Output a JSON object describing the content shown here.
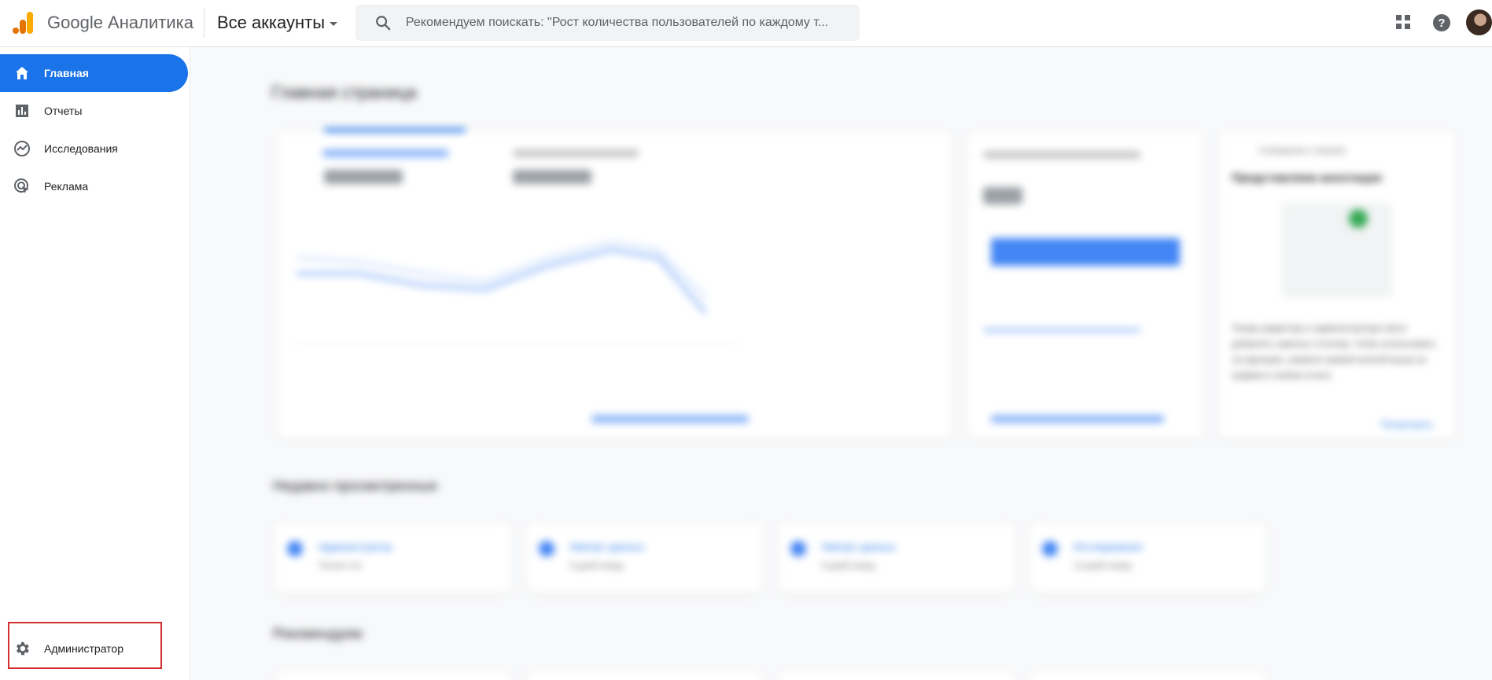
{
  "header": {
    "app_name": "Google Аналитика",
    "account_picker": "Все аккаунты",
    "search_placeholder": "Рекомендуем поискать: \"Рост количества пользователей по каждому т..."
  },
  "sidebar": {
    "items": [
      {
        "label": "Главная",
        "icon": "home-icon",
        "active": true
      },
      {
        "label": "Отчеты",
        "icon": "bar-chart-icon",
        "active": false
      },
      {
        "label": "Исследования",
        "icon": "explore-icon",
        "active": false
      },
      {
        "label": "Реклама",
        "icon": "ads-icon",
        "active": false
      }
    ],
    "admin_label": "Администратор"
  },
  "main": {
    "page_title": "Главная страница",
    "recent_title": "Недавно просмотренные",
    "recommended_title": "Рекомендуем",
    "recent_items": [
      {
        "title": "Администратор",
        "subtitle": "Только что"
      },
      {
        "title": "Импорт данных",
        "subtitle": "8 дней назад"
      },
      {
        "title": "Импорт данных",
        "subtitle": "8 дней назад"
      },
      {
        "title": "Исследования",
        "subtitle": "14 дней назад"
      }
    ],
    "insight_card": {
      "header": "Сообщение о запуске",
      "title": "Представляем аннотации",
      "body": "Теперь редакторы и администраторы могут добавлять заметки к отчетам. Чтобы использовать эту функцию, нажмите правой кнопкой мыши на графике в любом отчете.",
      "link": "Посмотреть"
    }
  },
  "colors": {
    "accent": "#1a73e8",
    "highlight_border": "#d32f2f",
    "logo_orange": "#f9ab00",
    "logo_dark_orange": "#e37400"
  }
}
